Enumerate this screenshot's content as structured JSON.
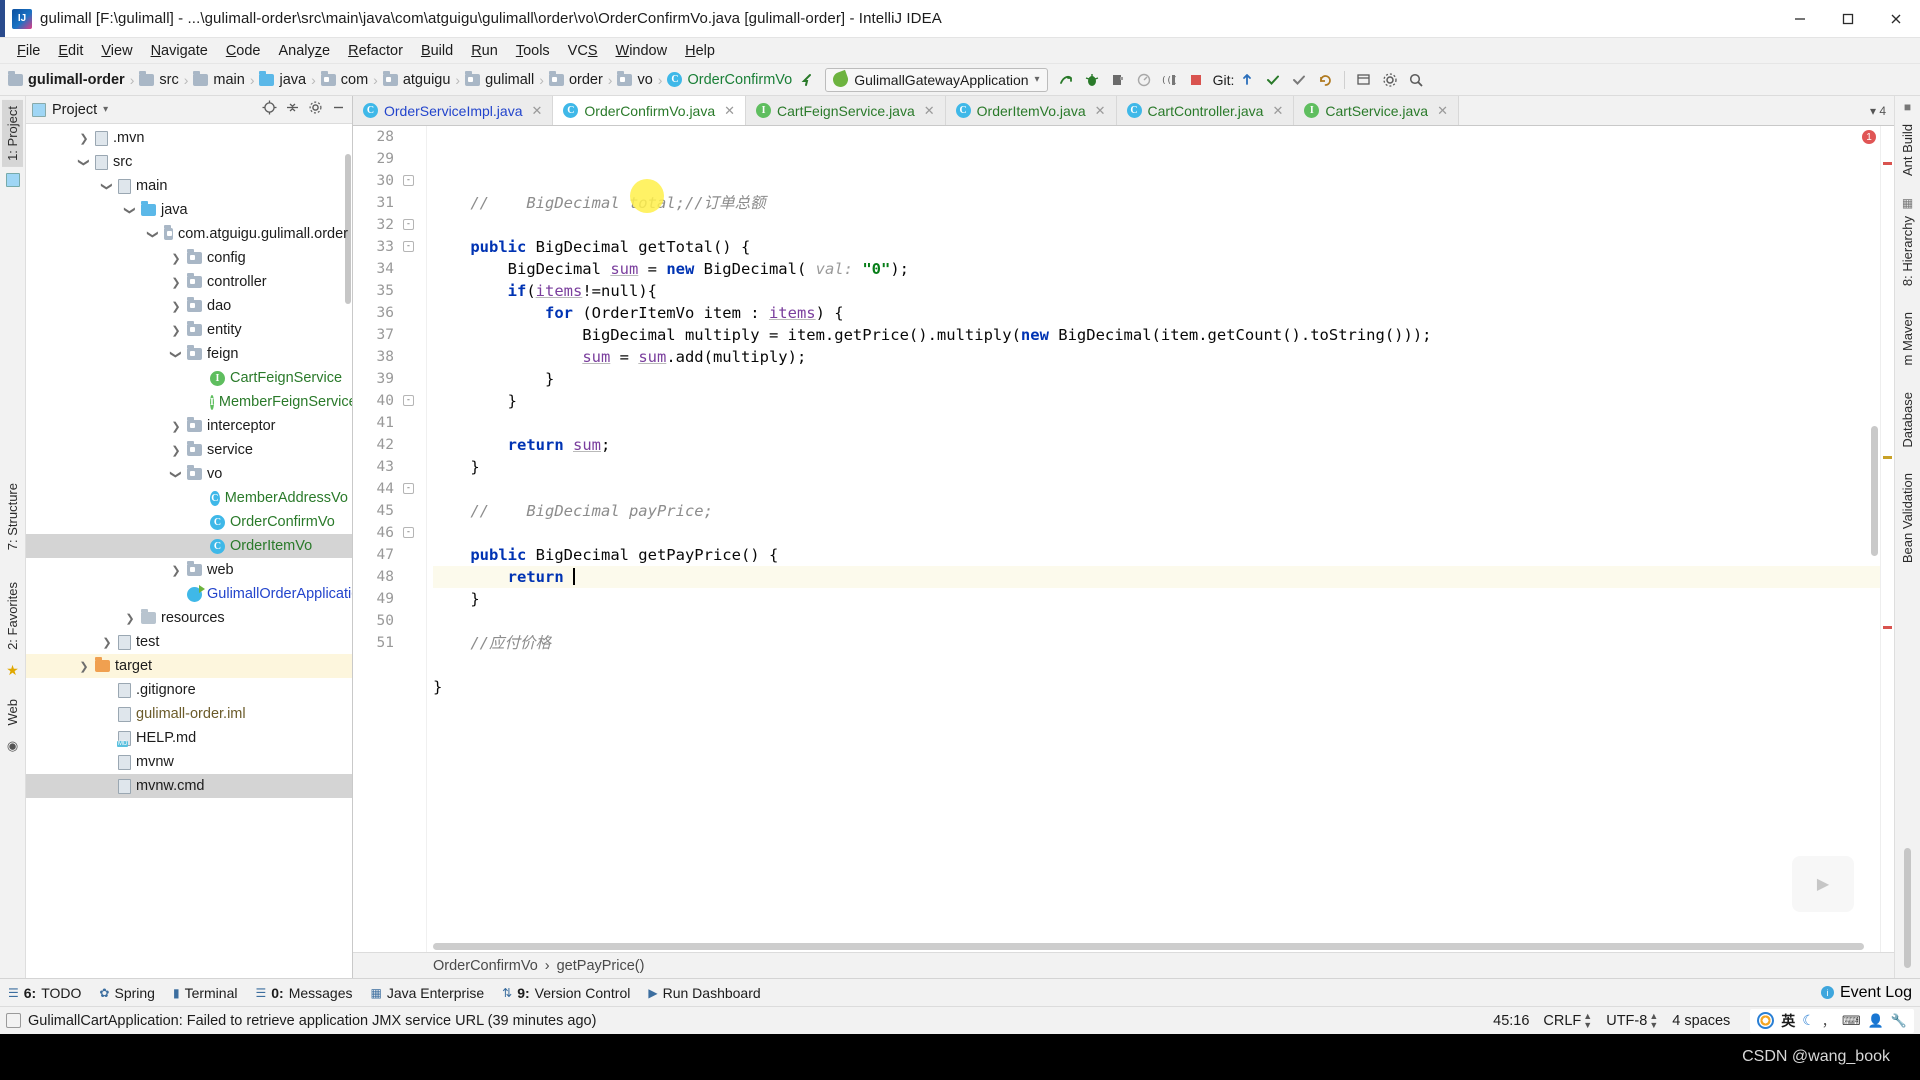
{
  "window": {
    "title": "gulimall [F:\\gulimall] - ...\\gulimall-order\\src\\main\\java\\com\\atguigu\\gulimall\\order\\vo\\OrderConfirmVo.java [gulimall-order] - IntelliJ IDEA",
    "minimize": "—",
    "maximize": "❐",
    "close": "✕"
  },
  "menubar": {
    "items": [
      {
        "label": "File",
        "mnemonic": "F"
      },
      {
        "label": "Edit",
        "mnemonic": "E"
      },
      {
        "label": "View",
        "mnemonic": "V"
      },
      {
        "label": "Navigate",
        "mnemonic": "N"
      },
      {
        "label": "Code",
        "mnemonic": "C"
      },
      {
        "label": "Analyze",
        "mnemonic": "z"
      },
      {
        "label": "Refactor",
        "mnemonic": "R"
      },
      {
        "label": "Build",
        "mnemonic": "B"
      },
      {
        "label": "Run",
        "mnemonic": "R"
      },
      {
        "label": "Tools",
        "mnemonic": "T"
      },
      {
        "label": "VCS",
        "mnemonic": "S"
      },
      {
        "label": "Window",
        "mnemonic": "W"
      },
      {
        "label": "Help",
        "mnemonic": "H"
      }
    ]
  },
  "navbar": {
    "crumbs": [
      {
        "label": "gulimall-order",
        "icon": "folder-icon",
        "style": "bold"
      },
      {
        "label": "src",
        "icon": "folder-icon",
        "style": "normal"
      },
      {
        "label": "main",
        "icon": "folder-icon",
        "style": "normal"
      },
      {
        "label": "java",
        "icon": "folder-blue-icon",
        "style": "normal"
      },
      {
        "label": "com",
        "icon": "package-icon",
        "style": "normal"
      },
      {
        "label": "atguigu",
        "icon": "package-icon",
        "style": "normal"
      },
      {
        "label": "gulimall",
        "icon": "package-icon",
        "style": "normal"
      },
      {
        "label": "order",
        "icon": "package-icon",
        "style": "normal"
      },
      {
        "label": "vo",
        "icon": "package-icon",
        "style": "normal"
      },
      {
        "label": "OrderConfirmVo",
        "icon": "class-icon",
        "style": "green"
      }
    ],
    "separator": "›",
    "run_config": "GulimallGatewayApplication",
    "git_label": "Git:"
  },
  "project_panel": {
    "title": "Project",
    "dropdown_caret": "▾",
    "tree": [
      {
        "label": ".mvn",
        "indent": 2,
        "arrow": "collapsed",
        "icon": "folder-icon",
        "color": "default"
      },
      {
        "label": "src",
        "indent": 2,
        "arrow": "expanded",
        "icon": "folder-icon",
        "color": "default"
      },
      {
        "label": "main",
        "indent": 3,
        "arrow": "expanded",
        "icon": "folder-icon",
        "color": "default"
      },
      {
        "label": "java",
        "indent": 4,
        "arrow": "expanded",
        "icon": "folder-blue-icon",
        "color": "default"
      },
      {
        "label": "com.atguigu.gulimall.order",
        "indent": 5,
        "arrow": "expanded",
        "icon": "package-icon",
        "color": "default"
      },
      {
        "label": "config",
        "indent": 6,
        "arrow": "collapsed",
        "icon": "package-icon",
        "color": "default"
      },
      {
        "label": "controller",
        "indent": 6,
        "arrow": "collapsed",
        "icon": "package-icon",
        "color": "default"
      },
      {
        "label": "dao",
        "indent": 6,
        "arrow": "collapsed",
        "icon": "package-icon",
        "color": "default"
      },
      {
        "label": "entity",
        "indent": 6,
        "arrow": "collapsed",
        "icon": "package-icon",
        "color": "default"
      },
      {
        "label": "feign",
        "indent": 6,
        "arrow": "expanded",
        "icon": "package-icon",
        "color": "default"
      },
      {
        "label": "CartFeignService",
        "indent": 7,
        "arrow": "none",
        "icon": "interface-icon",
        "color": "green"
      },
      {
        "label": "MemberFeignService",
        "indent": 7,
        "arrow": "none",
        "icon": "interface-icon",
        "color": "green"
      },
      {
        "label": "interceptor",
        "indent": 6,
        "arrow": "collapsed",
        "icon": "package-icon",
        "color": "default"
      },
      {
        "label": "service",
        "indent": 6,
        "arrow": "collapsed",
        "icon": "package-icon",
        "color": "default"
      },
      {
        "label": "vo",
        "indent": 6,
        "arrow": "expanded",
        "icon": "package-icon",
        "color": "default"
      },
      {
        "label": "MemberAddressVo",
        "indent": 7,
        "arrow": "none",
        "icon": "class-icon",
        "color": "green"
      },
      {
        "label": "OrderConfirmVo",
        "indent": 7,
        "arrow": "none",
        "icon": "class-icon",
        "color": "green"
      },
      {
        "label": "OrderItemVo",
        "indent": 7,
        "arrow": "none",
        "icon": "class-icon",
        "color": "green",
        "state": "selected"
      },
      {
        "label": "web",
        "indent": 6,
        "arrow": "collapsed",
        "icon": "package-icon",
        "color": "default"
      },
      {
        "label": "GulimallOrderApplication",
        "indent": 6,
        "arrow": "none",
        "icon": "spring-class-icon",
        "color": "blue"
      },
      {
        "label": "resources",
        "indent": 4,
        "arrow": "collapsed",
        "icon": "resources-folder-icon",
        "color": "default"
      },
      {
        "label": "test",
        "indent": 3,
        "arrow": "collapsed",
        "icon": "folder-icon",
        "color": "default"
      },
      {
        "label": "target",
        "indent": 2,
        "arrow": "collapsed",
        "icon": "folder-orange-icon",
        "color": "default",
        "state": "highlighted"
      },
      {
        "label": ".gitignore",
        "indent": 3,
        "arrow": "none",
        "icon": "file-icon",
        "color": "default"
      },
      {
        "label": "gulimall-order.iml",
        "indent": 3,
        "arrow": "none",
        "icon": "iml-file-icon",
        "color": "brown"
      },
      {
        "label": "HELP.md",
        "indent": 3,
        "arrow": "none",
        "icon": "markdown-file-icon",
        "color": "default"
      },
      {
        "label": "mvnw",
        "indent": 3,
        "arrow": "none",
        "icon": "file-icon",
        "color": "default"
      },
      {
        "label": "mvnw.cmd",
        "indent": 3,
        "arrow": "none",
        "icon": "file-icon",
        "color": "default",
        "state": "selected"
      }
    ]
  },
  "left_strip": {
    "items": [
      {
        "label": "1: Project",
        "selected": true
      },
      {
        "label": "7: Structure",
        "selected": false
      },
      {
        "label": "2: Favorites",
        "selected": false
      },
      {
        "label": "Web",
        "selected": false
      }
    ]
  },
  "right_strip": {
    "items": [
      {
        "label": "Ant Build"
      },
      {
        "label": "8: Hierarchy"
      },
      {
        "label": "m Maven"
      },
      {
        "label": "Database"
      },
      {
        "label": "Bean Validation"
      }
    ]
  },
  "editor": {
    "tabs": [
      {
        "label": "OrderServiceImpl.java",
        "icon": "class-icon",
        "color": "blue",
        "active": false,
        "close": "✕"
      },
      {
        "label": "OrderConfirmVo.java",
        "icon": "class-icon",
        "color": "green",
        "active": true,
        "close": "✕"
      },
      {
        "label": "CartFeignService.java",
        "icon": "interface-icon",
        "color": "green",
        "active": false,
        "close": "✕"
      },
      {
        "label": "OrderItemVo.java",
        "icon": "class-icon",
        "color": "green",
        "active": false,
        "close": "✕"
      },
      {
        "label": "CartController.java",
        "icon": "class-icon",
        "color": "green",
        "active": false,
        "close": "✕"
      },
      {
        "label": "CartService.java",
        "icon": "interface-icon",
        "color": "green",
        "active": false,
        "close": "✕"
      }
    ],
    "tab_overflow": "▾ 4",
    "first_line_number": 28,
    "lines": [
      {
        "n": 28,
        "fold": "",
        "code": "    //    BigDecimal total;//订单总额",
        "cur": false
      },
      {
        "n": 29,
        "fold": "",
        "code": "",
        "cur": false
      },
      {
        "n": 30,
        "fold": "-",
        "code": "    public BigDecimal getTotal() {",
        "cur": false
      },
      {
        "n": 31,
        "fold": "",
        "code": "        BigDecimal sum = new BigDecimal( val: \"0\");",
        "cur": false
      },
      {
        "n": 32,
        "fold": "-",
        "code": "        if(items!=null){",
        "cur": false
      },
      {
        "n": 33,
        "fold": "-",
        "code": "            for (OrderItemVo item : items) {",
        "cur": false
      },
      {
        "n": 34,
        "fold": "",
        "code": "                BigDecimal multiply = item.getPrice().multiply(new BigDecimal(item.getCount().toString()));",
        "cur": false
      },
      {
        "n": 35,
        "fold": "",
        "code": "                sum = sum.add(multiply);",
        "cur": false
      },
      {
        "n": 36,
        "fold": "",
        "code": "            }",
        "cur": false
      },
      {
        "n": 37,
        "fold": "",
        "code": "        }",
        "cur": false
      },
      {
        "n": 38,
        "fold": "",
        "code": "",
        "cur": false
      },
      {
        "n": 39,
        "fold": "",
        "code": "        return sum;",
        "cur": false
      },
      {
        "n": 40,
        "fold": "-",
        "code": "    }",
        "cur": false
      },
      {
        "n": 41,
        "fold": "",
        "code": "",
        "cur": false
      },
      {
        "n": 42,
        "fold": "",
        "code": "    //    BigDecimal payPrice;",
        "cur": false
      },
      {
        "n": 43,
        "fold": "",
        "code": "",
        "cur": false
      },
      {
        "n": 44,
        "fold": "-",
        "code": "    public BigDecimal getPayPrice() {",
        "cur": false
      },
      {
        "n": 45,
        "fold": "",
        "code": "        return ",
        "cur": true
      },
      {
        "n": 46,
        "fold": "-",
        "code": "    }",
        "cur": false
      },
      {
        "n": 47,
        "fold": "",
        "code": "",
        "cur": false
      },
      {
        "n": 48,
        "fold": "",
        "code": "    //应付价格",
        "cur": false
      },
      {
        "n": 49,
        "fold": "",
        "code": "",
        "cur": false
      },
      {
        "n": 50,
        "fold": "",
        "code": "}",
        "cur": false
      },
      {
        "n": 51,
        "fold": "",
        "code": "",
        "cur": false
      }
    ],
    "error_count": "1",
    "breadcrumb": [
      "OrderConfirmVo",
      "getPayPrice()"
    ],
    "breadcrumb_sep": "›"
  },
  "bottom_bar": {
    "items": [
      {
        "num": "6",
        "label": "TODO",
        "icon": "todo-icon"
      },
      {
        "num": "",
        "label": "Spring",
        "icon": "spring-icon"
      },
      {
        "num": "",
        "label": "Terminal",
        "icon": "terminal-icon"
      },
      {
        "num": "0",
        "label": "Messages",
        "icon": "messages-icon"
      },
      {
        "num": "",
        "label": "Java Enterprise",
        "icon": "java-enterprise-icon"
      },
      {
        "num": "9",
        "label": "Version Control",
        "icon": "version-control-icon"
      },
      {
        "num": "",
        "label": "Run Dashboard",
        "icon": "run-dashboard-icon"
      }
    ],
    "event_log": "Event Log"
  },
  "status_bar": {
    "message": "GulimallCartApplication: Failed to retrieve application JMX service URL (39 minutes ago)",
    "position": "45:16",
    "line_separator": "CRLF",
    "encoding": "UTF-8",
    "indent": "4 spaces",
    "ime": {
      "lang": "英",
      "moon": "☾",
      "comma": "，",
      "keyboard": "⌨",
      "person": "👤",
      "wrench": "🔧"
    }
  },
  "footer": {
    "watermark": "CSDN @wang_book"
  }
}
